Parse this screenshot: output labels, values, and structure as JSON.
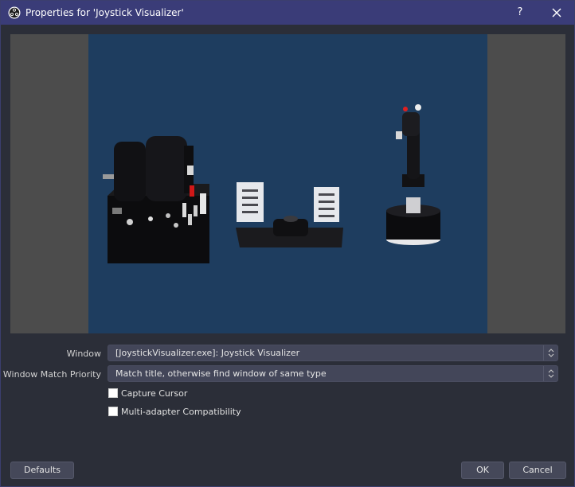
{
  "window": {
    "title": "Properties for 'Joystick Visualizer'",
    "help_label": "?",
    "accent_color": "#3a3c78"
  },
  "preview": {
    "canvas_color": "#1e3d5f",
    "letterbox_color": "#4c4c4c"
  },
  "form": {
    "window_label": "Window",
    "window_value": "[JoystickVisualizer.exe]: Joystick Visualizer",
    "priority_label": "Window Match Priority",
    "priority_value": "Match title, otherwise find window of same type",
    "capture_cursor_label": "Capture Cursor",
    "capture_cursor_checked": false,
    "multi_adapter_label": "Multi-adapter Compatibility",
    "multi_adapter_checked": false
  },
  "buttons": {
    "defaults": "Defaults",
    "ok": "OK",
    "cancel": "Cancel"
  }
}
